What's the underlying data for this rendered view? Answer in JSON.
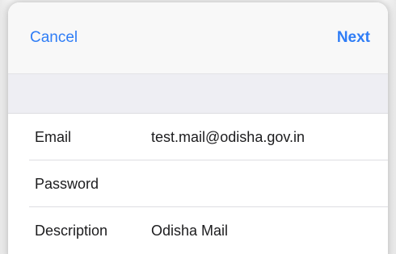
{
  "navbar": {
    "cancel_label": "Cancel",
    "next_label": "Next"
  },
  "colors": {
    "accent": "#2f7df6",
    "text": "#1c1c1e",
    "group_background": "#eeeef3"
  },
  "form": {
    "rows": [
      {
        "label": "Email",
        "value": "test.mail@odisha.gov.in"
      },
      {
        "label": "Password",
        "value": ""
      },
      {
        "label": "Description",
        "value": "Odisha Mail"
      }
    ]
  }
}
